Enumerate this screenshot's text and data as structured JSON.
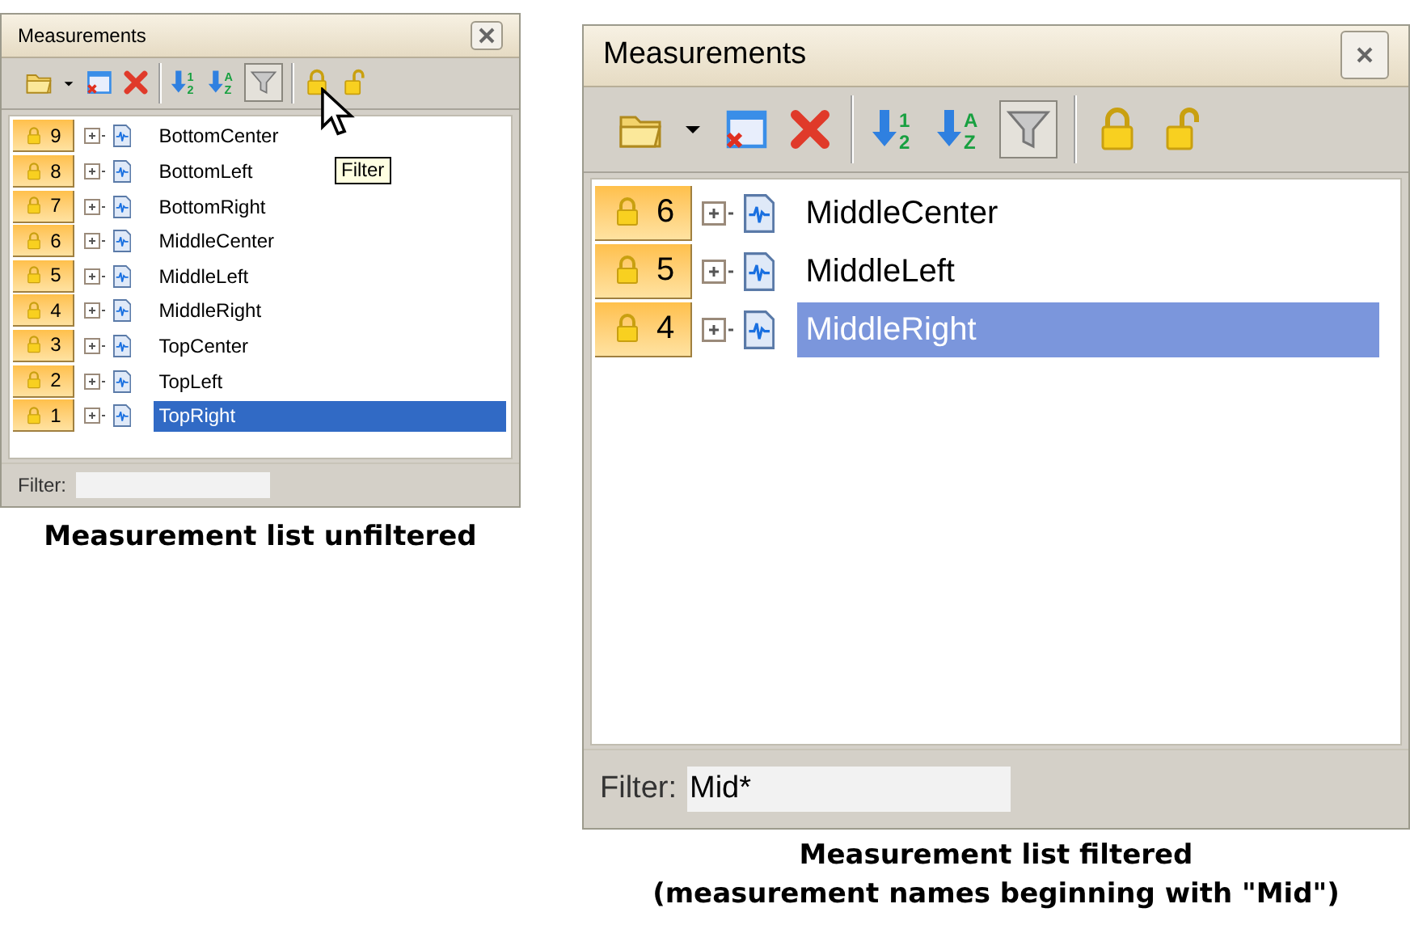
{
  "panels": [
    {
      "title": "Measurements",
      "toolbar": {
        "sort_numeric": [
          "1",
          "2"
        ],
        "sort_alpha": [
          "A",
          "Z"
        ],
        "filter_pressed": true
      },
      "tooltip": "Filter",
      "list_focused": true,
      "rows": [
        {
          "number": "9",
          "name": "BottomCenter",
          "selected": false
        },
        {
          "number": "8",
          "name": "BottomLeft",
          "selected": false
        },
        {
          "number": "7",
          "name": "BottomRight",
          "selected": false
        },
        {
          "number": "6",
          "name": "MiddleCenter",
          "selected": false
        },
        {
          "number": "5",
          "name": "MiddleLeft",
          "selected": false
        },
        {
          "number": "4",
          "name": "MiddleRight",
          "selected": false
        },
        {
          "number": "3",
          "name": "TopCenter",
          "selected": false
        },
        {
          "number": "2",
          "name": "TopLeft",
          "selected": false
        },
        {
          "number": "1",
          "name": "TopRight",
          "selected": true
        }
      ],
      "filter": {
        "label": "Filter:"
      },
      "caption": [
        "Measurement list unfiltered"
      ]
    },
    {
      "title": "Measurements",
      "toolbar": {
        "sort_numeric": [
          "1",
          "2"
        ],
        "sort_alpha": [
          "A",
          "Z"
        ],
        "filter_pressed": true
      },
      "list_focused": false,
      "rows": [
        {
          "number": "6",
          "name": "MiddleCenter",
          "selected": false
        },
        {
          "number": "5",
          "name": "MiddleLeft",
          "selected": false
        },
        {
          "number": "4",
          "name": "MiddleRight",
          "selected": true
        }
      ],
      "filter": {
        "label": "Filter:",
        "value": "Mid*"
      },
      "caption": [
        "Measurement list filtered",
        "(measurement names beginning with \"Mid\")"
      ]
    }
  ]
}
